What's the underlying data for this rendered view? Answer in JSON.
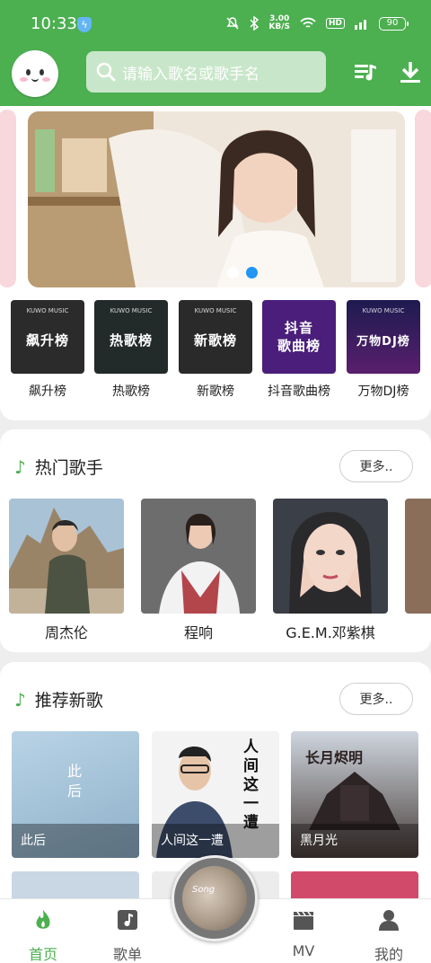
{
  "status_bar": {
    "time": "10:33",
    "net_speed_value": "3.00",
    "net_speed_unit": "KB/S",
    "hd_label": "HD",
    "battery": "90"
  },
  "header": {
    "search_placeholder": "请输入歌名或歌手名",
    "accent_color": "#4caf50"
  },
  "banner": {
    "dots_total": 2,
    "dots_active_index": 1
  },
  "charts": [
    {
      "label": "飙升榜",
      "tile_text": "飙升榜",
      "brand": "KUWO MUSIC",
      "bg": "#2b2b2b"
    },
    {
      "label": "热歌榜",
      "tile_text": "热歌榜",
      "brand": "KUWO MUSIC",
      "bg": "#222a2a"
    },
    {
      "label": "新歌榜",
      "tile_text": "新歌榜",
      "brand": "KUWO MUSIC",
      "bg": "#2a2a2a"
    },
    {
      "label": "抖音歌曲榜",
      "tile_text": "抖音\n歌曲榜",
      "brand": "",
      "bg": "#4a1e7a"
    },
    {
      "label": "万物DJ榜",
      "tile_text": "万物DJ榜",
      "brand": "KUWO MUSIC",
      "bg": "#2a1f5e"
    }
  ],
  "hot_singers": {
    "title": "热门歌手",
    "more_label": "更多..",
    "items": [
      {
        "name": "周杰伦"
      },
      {
        "name": "程响"
      },
      {
        "name": "G.E.M.邓紫棋"
      }
    ]
  },
  "new_songs": {
    "title": "推荐新歌",
    "more_label": "更多..",
    "items": [
      {
        "name": "此后",
        "cover_text": "此\n后"
      },
      {
        "name": "人间这一遭",
        "cover_text": "人\n间\n这\n一\n遭"
      },
      {
        "name": "黑月光",
        "cover_text": "长月烬明"
      }
    ]
  },
  "bottom_nav": {
    "items": [
      {
        "label": "首页",
        "icon": "home-flame-icon",
        "active": true
      },
      {
        "label": "歌单",
        "icon": "playlist-icon",
        "active": false
      },
      {
        "label": "MV",
        "icon": "clapperboard-icon",
        "active": false
      },
      {
        "label": "我的",
        "icon": "person-icon",
        "active": false
      }
    ],
    "disc_text": "Song"
  }
}
